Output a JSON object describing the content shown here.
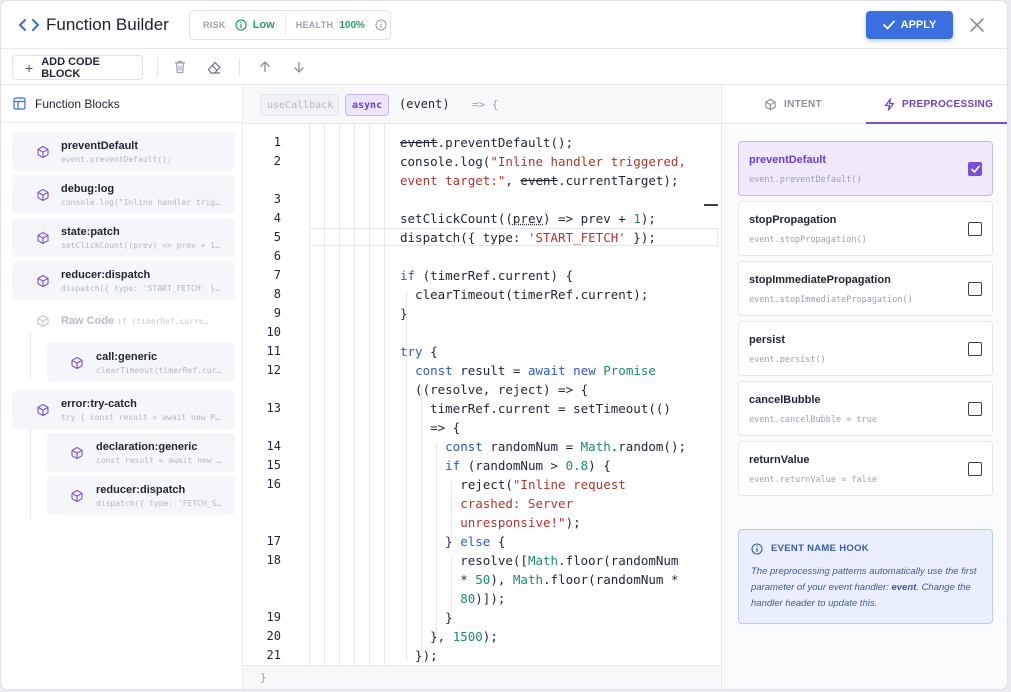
{
  "header": {
    "title": "Function Builder",
    "risk_label": "RISK",
    "risk_value": "Low",
    "health_label": "HEALTH",
    "health_value": "100%",
    "apply_label": "APPLY"
  },
  "toolbar": {
    "add_label": "ADD CODE BLOCK"
  },
  "sidebar": {
    "title": "Function Blocks",
    "blocks": [
      {
        "name": "preventDefault",
        "code": "event.preventDefault();"
      },
      {
        "name": "debug:log",
        "code": "console.log(\"Inline handler trig…"
      },
      {
        "name": "state:patch",
        "code": "setClickCount((prev) => prev + 1…"
      },
      {
        "name": "reducer:dispatch",
        "code": "dispatch({ type: 'START_FETCH' }…"
      },
      {
        "name": "Raw Code",
        "code": "if (timerRef.curre…"
      },
      {
        "name": "call:generic",
        "code": "clearTimeout(timerRef.cur…"
      },
      {
        "name": "error:try-catch",
        "code": "try { const result = await new P…"
      },
      {
        "name": "declaration:generic",
        "code": "const result = await new …"
      },
      {
        "name": "reducer:dispatch",
        "code": "dispatch({ type: 'FETCH_S…"
      }
    ]
  },
  "editor": {
    "chip_usecallback": "useCallback",
    "chip_async": "async",
    "signature": "(event)",
    "arrow": "=> {",
    "closing": "}",
    "line_numbers": [
      "1",
      "2",
      "3",
      "4",
      "5",
      "6",
      "7",
      "8",
      "9",
      "10",
      "11",
      "12",
      "13",
      "14",
      "15",
      "16",
      "17",
      "18",
      "19",
      "20",
      "21"
    ]
  },
  "right_panel": {
    "tab_intent": "INTENT",
    "tab_preprocessing": "PREPROCESSING",
    "options": [
      {
        "name": "preventDefault",
        "code": "event.preventDefault()",
        "checked": true
      },
      {
        "name": "stopPropagation",
        "code": "event.stopPropagation()",
        "checked": false
      },
      {
        "name": "stopImmediatePropagation",
        "code": "event.stopImmediatePropagation()",
        "checked": false
      },
      {
        "name": "persist",
        "code": "event.persist()",
        "checked": false
      },
      {
        "name": "cancelBubble",
        "code": "event.cancelBubble = true",
        "checked": false
      },
      {
        "name": "returnValue",
        "code": "event.returnValue = false",
        "checked": false
      }
    ],
    "hook_title": "EVENT NAME HOOK",
    "hook_text_1": "The preprocessing patterns automatically use the first parameter of your event handler: ",
    "hook_text_bold": "event",
    "hook_text_2": ". Change the handler header to update this."
  },
  "colors": {
    "accent": "#3a6fe0",
    "purple": "#7a4ee0",
    "health_green": "#22a35a"
  }
}
